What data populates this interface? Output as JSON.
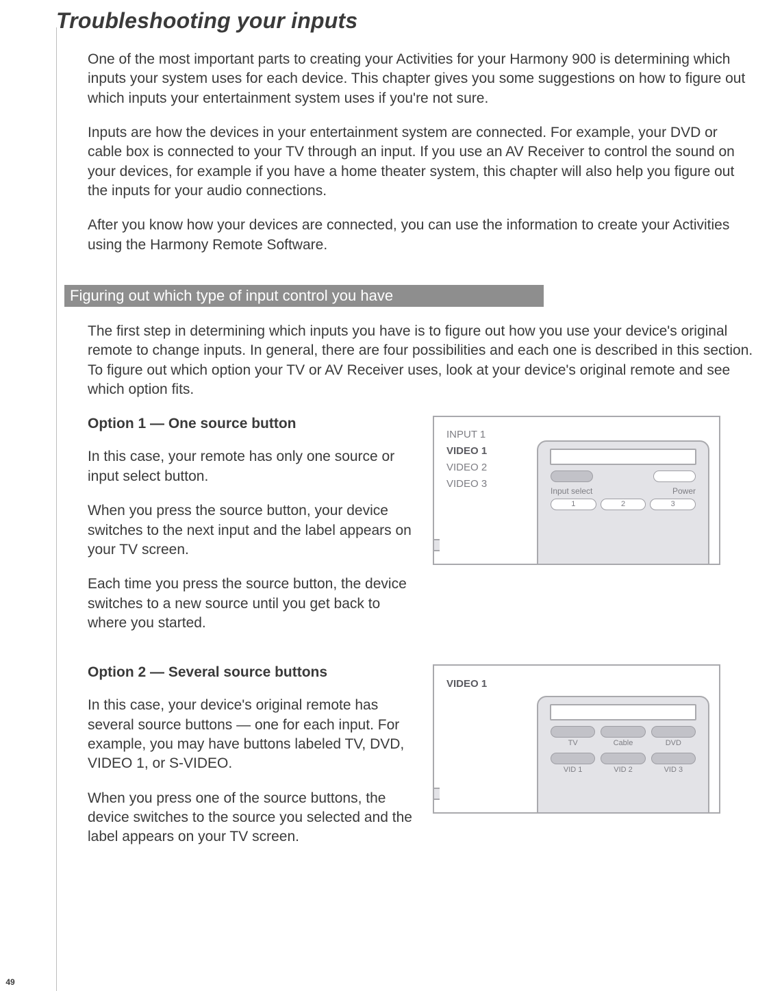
{
  "page_number": "49",
  "title": "Troubleshooting your inputs",
  "intro": {
    "p1": "One of the most important parts to creating your Activities for your Harmony 900 is determining which inputs your system uses for each device. This chapter gives you some suggestions on how to figure out which inputs your entertainment system uses if you're not sure.",
    "p2": "Inputs are how the devices in your entertainment system are connected. For example, your DVD or cable box is connected to your TV through an input. If you use an AV Receiver to control the sound on your devices, for example if you have a home theater system, this chapter will also help you figure out the inputs for your audio connections.",
    "p3": "After you know how your devices are connected, you can use the information to create your Activities using the Harmony Remote Software."
  },
  "section_heading": "Figuring out which type of input control you have",
  "section_intro": "The first step in determining which inputs you have is to figure out how you use your device's original remote to change inputs. In general, there are four possibilities and each one is described in this section. To figure out which option your TV or AV Receiver uses, look at your device's original remote and see which option fits.",
  "option1": {
    "heading": "Option 1 — One source button",
    "p1": "In this case, your remote has only one source or input select button.",
    "p2": "When you press the source button, your device switches to the next input and the label appears on your TV screen.",
    "p3": "Each time you press the source button, the device switches to a new source until you get back to where you started.",
    "screen_items": [
      "INPUT 1",
      "VIDEO 1",
      "VIDEO 2",
      "VIDEO 3"
    ],
    "screen_active_index": 1,
    "remote_labels": {
      "left": "Input select",
      "right": "Power"
    },
    "remote_nums": [
      "1",
      "2",
      "3"
    ]
  },
  "option2": {
    "heading": "Option 2 — Several source buttons",
    "p1": "In this case, your device's original remote has several source buttons — one for each input. For example, you may have buttons labeled TV, DVD, VIDEO 1, or S-VIDEO.",
    "p2": "When you press one of the source buttons, the device switches to the source you selected and the label appears on your TV screen.",
    "screen_label": "VIDEO 1",
    "remote_row1": [
      "TV",
      "Cable",
      "DVD"
    ],
    "remote_row2": [
      "VID 1",
      "VID 2",
      "VID 3"
    ]
  }
}
